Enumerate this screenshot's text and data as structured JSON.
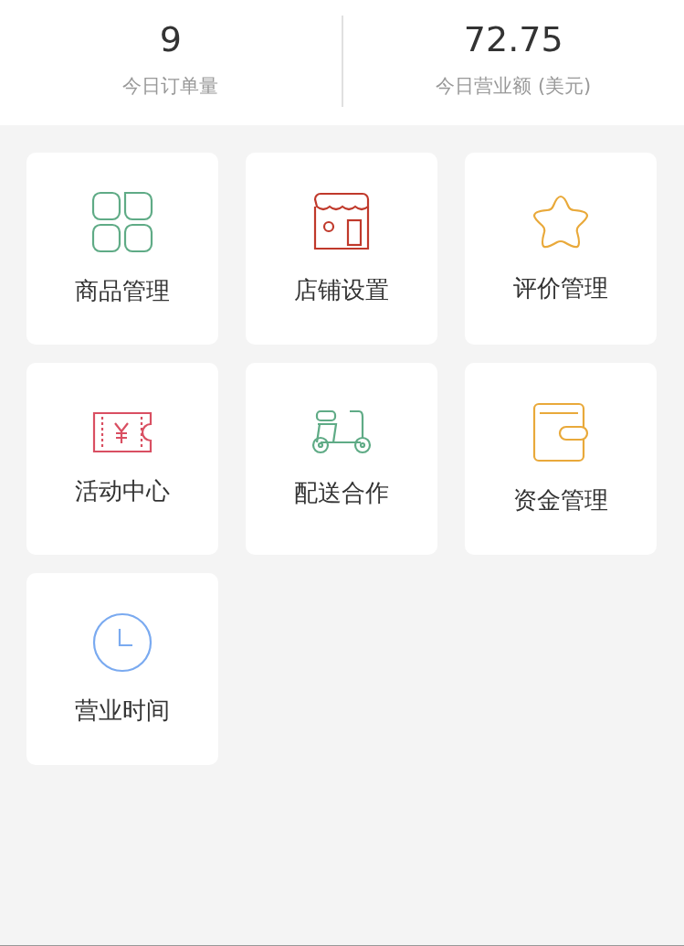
{
  "stats": [
    {
      "value": "9",
      "label": "今日订单量"
    },
    {
      "value": "72.75",
      "label": "今日营业额 (美元)"
    }
  ],
  "menu": [
    {
      "kind": "grid",
      "color": "#5fab86",
      "label": "商品管理"
    },
    {
      "kind": "shop",
      "color": "#c0392b",
      "label": "店铺设置"
    },
    {
      "kind": "star",
      "color": "#e9a93a",
      "label": "评价管理"
    },
    {
      "kind": "ticket",
      "color": "#d94f62",
      "label": "活动中心"
    },
    {
      "kind": "scooter",
      "color": "#5fab86",
      "label": "配送合作"
    },
    {
      "kind": "wallet",
      "color": "#e9a93a",
      "label": "资金管理"
    },
    {
      "kind": "clock",
      "color": "#7aaaf0",
      "label": "营业时间"
    }
  ]
}
